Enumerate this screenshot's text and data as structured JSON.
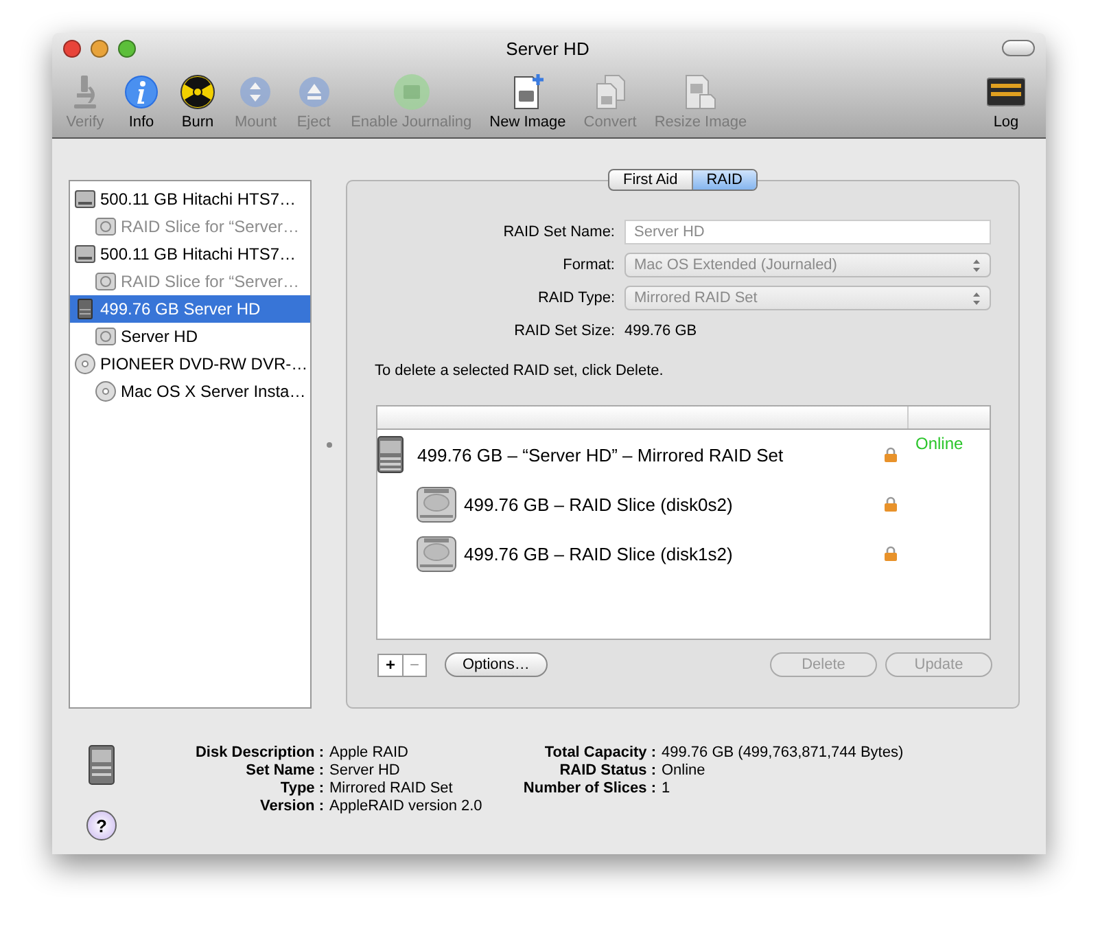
{
  "window": {
    "title": "Server HD"
  },
  "toolbar": [
    {
      "label": "Verify",
      "kind": "microscope",
      "disabled": true
    },
    {
      "label": "Info",
      "kind": "info",
      "disabled": false
    },
    {
      "label": "Burn",
      "kind": "burn",
      "disabled": false
    },
    {
      "label": "Mount",
      "kind": "mount",
      "disabled": true
    },
    {
      "label": "Eject",
      "kind": "eject",
      "disabled": true
    },
    {
      "label": "Enable Journaling",
      "kind": "journal",
      "disabled": true
    },
    {
      "label": "New Image",
      "kind": "newimage",
      "disabled": false
    },
    {
      "label": "Convert",
      "kind": "convert",
      "disabled": true
    },
    {
      "label": "Resize Image",
      "kind": "resize",
      "disabled": true
    },
    {
      "label": "Log",
      "kind": "log",
      "disabled": false
    }
  ],
  "sidebar": {
    "items": [
      {
        "label": "500.11 GB Hitachi HTS7…",
        "kind": "disk",
        "dimmed": false,
        "selected": false,
        "children": [
          {
            "label": "RAID Slice for “Server…",
            "kind": "volume",
            "dimmed": true,
            "selected": false
          }
        ]
      },
      {
        "label": "500.11 GB Hitachi HTS7…",
        "kind": "disk",
        "dimmed": false,
        "selected": false,
        "children": [
          {
            "label": "RAID Slice for “Server…",
            "kind": "volume",
            "dimmed": true,
            "selected": false
          }
        ]
      },
      {
        "label": "499.76 GB Server HD",
        "kind": "raid",
        "dimmed": false,
        "selected": true,
        "children": [
          {
            "label": "Server HD",
            "kind": "volume",
            "dimmed": false,
            "selected": false
          }
        ]
      },
      {
        "label": "PIONEER DVD-RW DVR-…",
        "kind": "optical",
        "dimmed": false,
        "selected": false,
        "children": [
          {
            "label": "Mac OS X Server Insta…",
            "kind": "optical",
            "dimmed": false,
            "selected": false
          }
        ]
      }
    ]
  },
  "tabs": [
    {
      "label": "First Aid",
      "selected": false
    },
    {
      "label": "RAID",
      "selected": true
    }
  ],
  "raid_form": {
    "disabled": true,
    "fields": [
      {
        "label": "RAID Set Name:",
        "value": "Server HD",
        "kind": "text"
      },
      {
        "label": "Format:",
        "value": "Mac OS Extended (Journaled)",
        "kind": "popup"
      },
      {
        "label": "RAID Type:",
        "value": "Mirrored RAID Set",
        "kind": "popup"
      },
      {
        "label": "RAID Set Size:",
        "value": "499.76 GB",
        "kind": "static"
      }
    ]
  },
  "hint": "To delete a selected RAID set, click Delete.",
  "raid_table": {
    "rows": [
      {
        "label": "499.76 GB – “Server HD” – Mirrored RAID Set",
        "kind": "set",
        "locked": true,
        "status": "Online",
        "children": [
          {
            "label": "499.76 GB – RAID Slice (disk0s2)",
            "kind": "slice",
            "locked": true
          },
          {
            "label": "499.76 GB – RAID Slice (disk1s2)",
            "kind": "slice",
            "locked": true
          }
        ]
      }
    ]
  },
  "table_buttons": [
    {
      "label": "+",
      "disabled": false
    },
    {
      "label": "−",
      "disabled": true
    }
  ],
  "buttons": [
    {
      "label": "Options…",
      "disabled": false
    },
    {
      "label": "Delete",
      "disabled": true
    },
    {
      "label": "Update",
      "disabled": true
    }
  ],
  "info": {
    "left": [
      {
        "label": "Disk Description :",
        "value": "Apple RAID"
      },
      {
        "label": "Set Name :",
        "value": "Server HD"
      },
      {
        "label": "Type :",
        "value": "Mirrored RAID Set"
      },
      {
        "label": "Version :",
        "value": "AppleRAID version 2.0"
      }
    ],
    "right": [
      {
        "label": "Total Capacity :",
        "value": "499.76 GB (499,763,871,744 Bytes)"
      },
      {
        "label": "RAID Status :",
        "value": "Online"
      },
      {
        "label": "Number of Slices :",
        "value": "1"
      }
    ]
  },
  "help": "?"
}
